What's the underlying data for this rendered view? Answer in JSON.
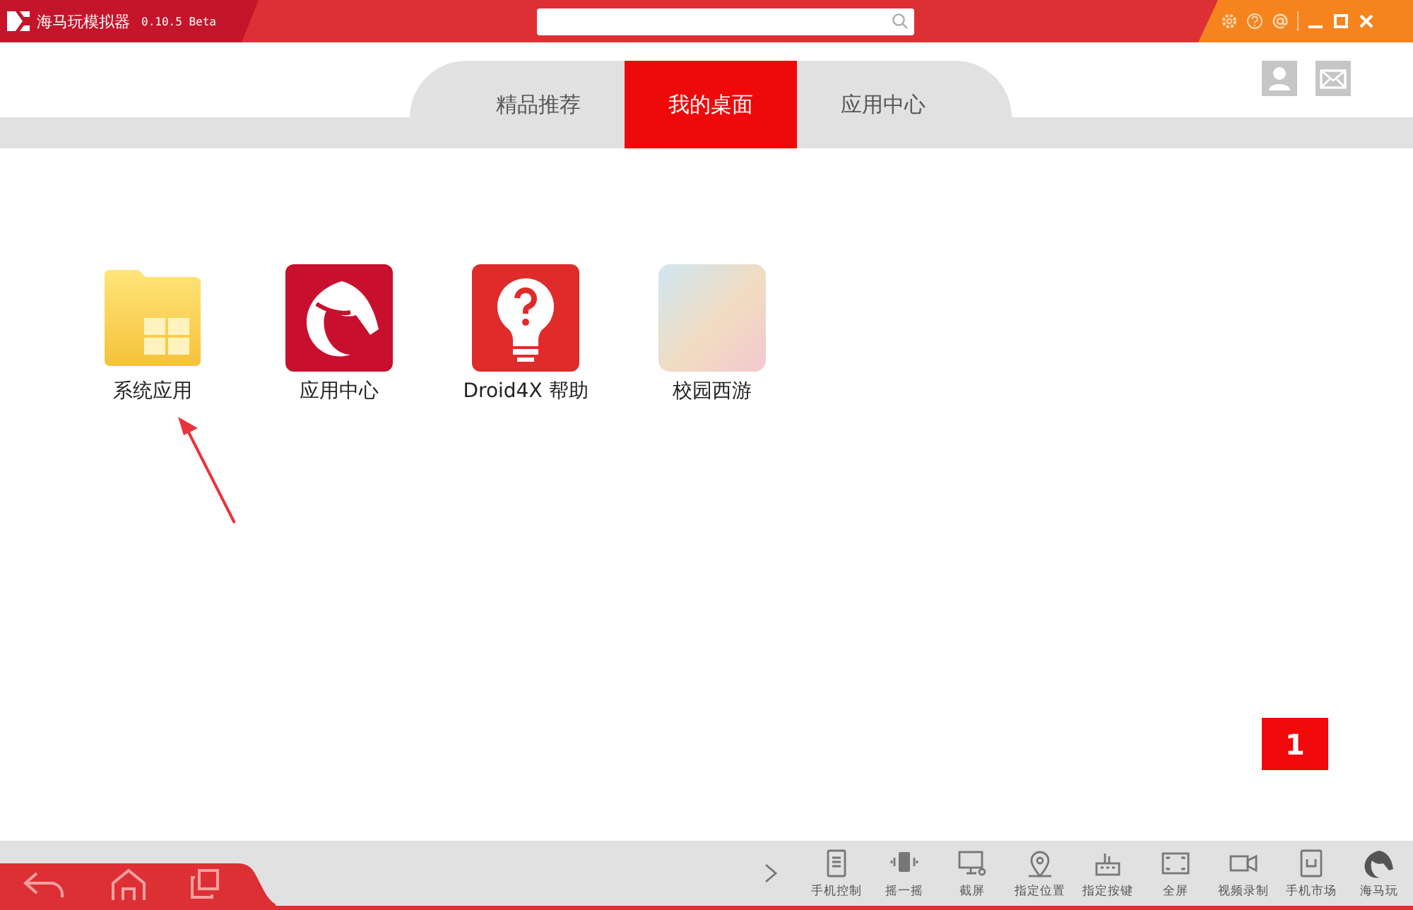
{
  "window": {
    "title": "海马玩模拟器",
    "version": "0.10.5 Beta"
  },
  "tabs": [
    {
      "label": "精品推荐",
      "selected": false
    },
    {
      "label": "我的桌面",
      "selected": true
    },
    {
      "label": "应用中心",
      "selected": false
    }
  ],
  "desktop_apps": [
    {
      "label": "系统应用",
      "kind": "folder"
    },
    {
      "label": "应用中心",
      "kind": "horse"
    },
    {
      "label": "Droid4X 帮助",
      "kind": "help"
    },
    {
      "label": "校园西游",
      "kind": "game"
    }
  ],
  "page_indicator": "1",
  "toolbar": [
    {
      "label": "手机控制",
      "kind": "phone"
    },
    {
      "label": "摇一摇",
      "kind": "shake"
    },
    {
      "label": "截屏",
      "kind": "screenshot"
    },
    {
      "label": "指定位置",
      "kind": "location"
    },
    {
      "label": "指定按键",
      "kind": "keys"
    },
    {
      "label": "全屏",
      "kind": "fullscreen"
    },
    {
      "label": "视频录制",
      "kind": "record"
    },
    {
      "label": "手机市场",
      "kind": "market"
    },
    {
      "label": "海马玩",
      "kind": "logo"
    }
  ]
}
